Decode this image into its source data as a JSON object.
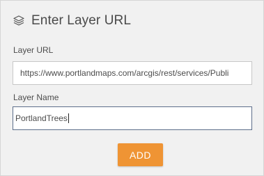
{
  "header": {
    "title": "Enter Layer URL",
    "icon": "layers-icon"
  },
  "form": {
    "url_label": "Layer URL",
    "url_value": "https://www.portlandmaps.com/arcgis/rest/services/Publi",
    "name_label": "Layer Name",
    "name_value": "PortlandTrees",
    "add_label": "ADD"
  },
  "colors": {
    "panel_bg": "#f1f1f1",
    "button_bg": "#ef9434",
    "focused_border": "#5c6d8a"
  }
}
